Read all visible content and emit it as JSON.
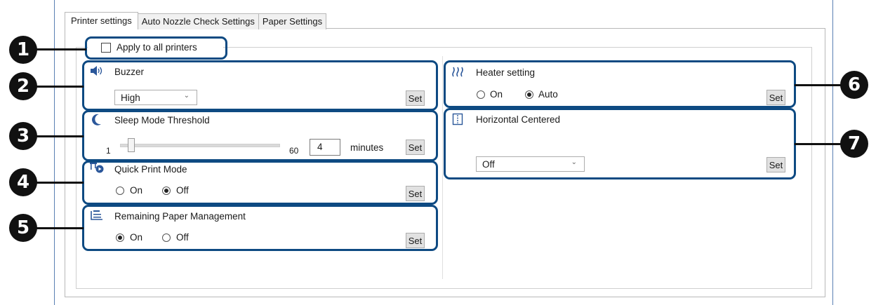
{
  "tabs": [
    {
      "label": "Printer settings",
      "active": true
    },
    {
      "label": "Auto Nozzle Check Settings",
      "active": false
    },
    {
      "label": "Paper Settings",
      "active": false
    }
  ],
  "apply_all": {
    "label": "Apply to all printers",
    "checked": false
  },
  "callouts": [
    "1",
    "2",
    "3",
    "4",
    "5",
    "6",
    "7"
  ],
  "buzzer": {
    "icon": "speaker-icon",
    "title": "Buzzer",
    "selected": "High",
    "set_label": "Set"
  },
  "sleep": {
    "icon": "moon-icon",
    "title": "Sleep Mode Threshold",
    "min_label": "1",
    "max_label": "60",
    "value": "4",
    "unit": "minutes",
    "set_label": "Set",
    "slider_min": 1,
    "slider_max": 60,
    "slider_value": 4
  },
  "quick_print": {
    "icon": "quick-print-icon",
    "title": "Quick Print Mode",
    "options": [
      "On",
      "Off"
    ],
    "selected": "Off",
    "set_label": "Set"
  },
  "remaining_paper": {
    "icon": "paper-roll-icon",
    "title": "Remaining Paper Management",
    "options": [
      "On",
      "Off"
    ],
    "selected": "On",
    "set_label": "Set"
  },
  "heater": {
    "icon": "heater-icon",
    "title": "Heater setting",
    "options": [
      "On",
      "Auto"
    ],
    "selected": "Auto",
    "set_label": "Set"
  },
  "horizontal": {
    "icon": "horizontal-center-icon",
    "title": "Horizontal Centered",
    "selected": "Off",
    "set_label": "Set"
  },
  "colors": {
    "callout_border": "#0e4a82",
    "badge": "#111111",
    "frame_line": "#5a7fb3"
  }
}
